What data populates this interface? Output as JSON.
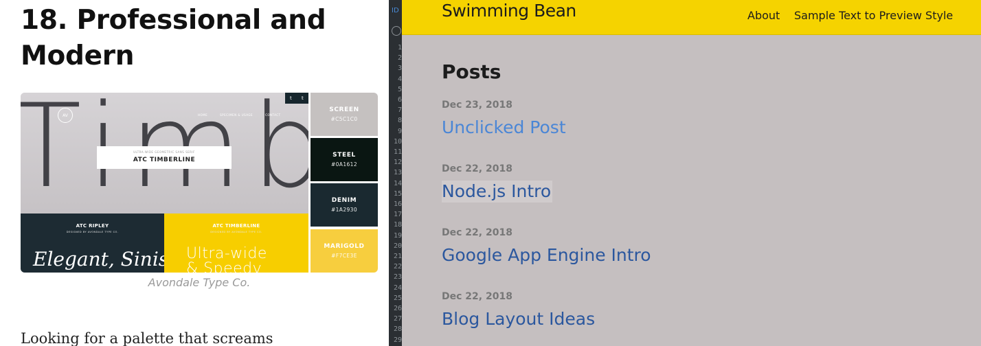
{
  "article": {
    "title_line1": "18. Professional and",
    "title_line2": "Modern",
    "hero": {
      "big_text": "Timbe",
      "logo": "AV",
      "nav": [
        "HOME",
        "SPECIMEN & USAGE",
        "CONTACT"
      ],
      "social": [
        "t",
        "𝕥"
      ],
      "card_subtitle": "ULTRA-WIDE GEOMETRIC SANS SERIF",
      "card_title": "ATC TIMBERLINE",
      "left_title": "ATC RIPLEY",
      "left_subtitle": "DESIGNED BY AVONDALE TYPE CO.",
      "left_script": "Elegant, Sinister,",
      "right_title": "ATC TIMBERLINE",
      "right_subtitle": "DESIGNED BY AVONDALE TYPE CO.",
      "right_line1": "Ultra-wide",
      "right_line2": "& Speedy",
      "colors": {
        "dark": "#1d2b33",
        "yellow": "#f7ce00"
      }
    },
    "swatches": [
      {
        "name": "SCREEN",
        "hex": "#C5C1C0",
        "color": "#c5c1c0"
      },
      {
        "name": "STEEL",
        "hex": "#0A1612",
        "color": "#0a1612"
      },
      {
        "name": "DENIM",
        "hex": "#1A2930",
        "color": "#1a2930"
      },
      {
        "name": "MARIGOLD",
        "hex": "#F7CE3E",
        "color": "#f7ce3e"
      }
    ],
    "caption": "Avondale Type Co.",
    "paragraph": "Looking for a palette that screams"
  },
  "editor": {
    "tab_label": "ID",
    "line_numbers": [
      "1",
      "2",
      "3",
      "4",
      "5",
      "6",
      "7",
      "8",
      "9",
      "10",
      "11",
      "12",
      "13",
      "14",
      "15",
      "16",
      "17",
      "18",
      "19",
      "20",
      "21",
      "22",
      "23",
      "24",
      "25",
      "26",
      "27",
      "28",
      "29"
    ]
  },
  "blog": {
    "site_title": "Swimming Bean",
    "nav": {
      "about": "About",
      "sample": "Sample Text to Preview Style"
    },
    "posts_heading": "Posts",
    "posts": [
      {
        "date": "Dec 23, 2018",
        "title": "Unclicked Post",
        "state": "unclicked"
      },
      {
        "date": "Dec 22, 2018",
        "title": "Node.js Intro",
        "state": "hover"
      },
      {
        "date": "Dec 22, 2018",
        "title": "Google App Engine Intro",
        "state": "visited"
      },
      {
        "date": "Dec 22, 2018",
        "title": "Blog Layout Ideas",
        "state": "visited"
      }
    ],
    "colors": {
      "header": "#f5d300",
      "background": "#c5bfc0",
      "link": "#2b579e",
      "unclicked_link": "#4a86d6"
    }
  }
}
